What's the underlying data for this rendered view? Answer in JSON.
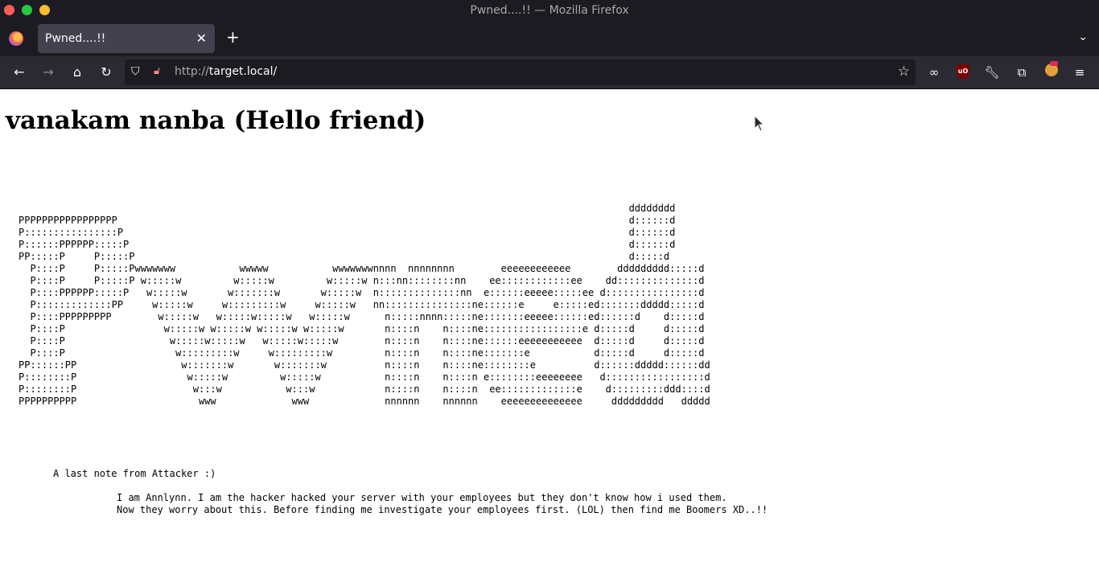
{
  "window": {
    "title": "Pwned....!! — Mozilla Firefox"
  },
  "tab": {
    "label": "Pwned....!!",
    "close_icon": "close-icon"
  },
  "navbar": {
    "url_scheme": "http://",
    "url_host": "target.local/"
  },
  "page": {
    "heading": "vanakam nanba (Hello friend)",
    "ascii_art": "                                                                                                         dddddddd\nPPPPPPPPPPPPPPPPP                                                                                        d::::::d\nP::::::::::::::::P                                                                                       d::::::d\nP::::::PPPPPP:::::P                                                                                      d::::::d\nPP:::::P     P:::::P                                                                                     d:::::d\n  P::::P     P:::::Pwwwwwww           wwwww           wwwwwwwnnnn  nnnnnnnn        eeeeeeeeeeee        ddddddddd:::::d\n  P::::P     P:::::P w:::::w         w:::::w         w:::::w n:::nn::::::::nn    ee::::::::::::ee    dd::::::::::::::d\n  P::::PPPPPP:::::P   w:::::w       w:::::::w       w:::::w  n::::::::::::::nn  e::::::eeeee:::::ee d::::::::::::::::d\n  P:::::::::::::PP     w:::::w     w:::::::::w     w:::::w   nn:::::::::::::::ne::::::e     e:::::ed:::::::ddddd:::::d\n  P::::PPPPPPPPP        w:::::w   w:::::w:::::w   w:::::w      n:::::nnnn:::::ne:::::::eeeee::::::ed::::::d    d:::::d\n  P::::P                 w:::::w w:::::w w:::::w w:::::w       n::::n    n::::ne:::::::::::::::::e d:::::d     d:::::d\n  P::::P                  w:::::w:::::w   w:::::w:::::w        n::::n    n::::ne::::::eeeeeeeeeee  d:::::d     d:::::d\n  P::::P                   w:::::::::w     w:::::::::w         n::::n    n::::ne:::::::e           d:::::d     d:::::d\nPP::::::PP                  w:::::::w       w:::::::w          n::::n    n::::ne::::::::e          d::::::ddddd::::::dd\nP::::::::P                   w:::::w         w:::::w           n::::n    n::::n e::::::::eeeeeeee   d:::::::::::::::::d\nP::::::::P                    w:::w           w:::w            n::::n    n::::n  ee:::::::::::::e    d:::::::::ddd::::d\nPPPPPPPPPP                     www             www             nnnnnn    nnnnnn    eeeeeeeeeeeeee     ddddddddd   ddddd",
    "note_title": "A last note from Attacker :)",
    "note_lines": [
      "I am Annlynn. I am the hacker hacked your server with your employees but they don't know how i used them.",
      "Now they worry about this. Before finding me investigate your employees first. (LOL) then find me Boomers XD..!!"
    ]
  }
}
